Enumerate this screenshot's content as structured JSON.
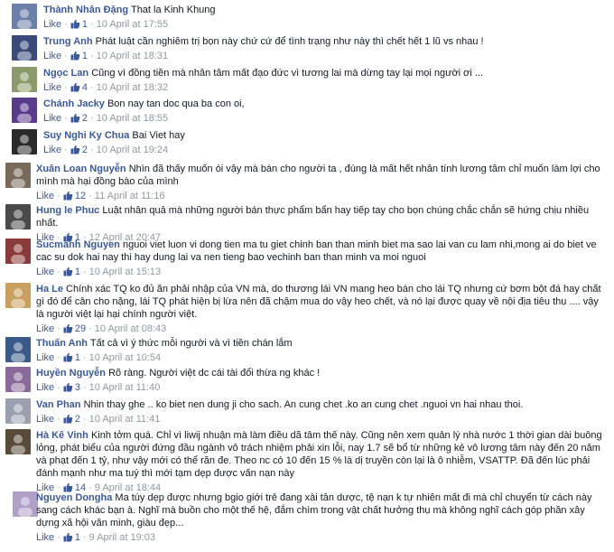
{
  "like_label": "Like",
  "separator": "·",
  "thumb_icon": "thumbs-up-icon",
  "link_color": "#3b5998",
  "comments": [
    {
      "author": "Thành Nhân Đặng",
      "text": "That la Kinh Khung",
      "likes": "1",
      "time": "10 April at 17:55",
      "avatar_color": "#6b7fa8"
    },
    {
      "author": "Trung Anh",
      "text": "Phát luật cần nghiêm trị bọn này chứ cứ để tình trạng như này thì chết hết 1 lũ vs nhau !",
      "likes": "1",
      "time": "10 April at 18:31",
      "avatar_color": "#3a4a7a"
    },
    {
      "author": "Ngọc Lan",
      "text": "Cũng vì đồng tiền mà nhân tâm mất đạo đức vì tương lai mà dừng tay lại mọi người ơi ...",
      "likes": "4",
      "time": "10 April at 18:32",
      "avatar_color": "#8a9a6a"
    },
    {
      "author": "Chánh Jacky",
      "text": "Bon nay tan doc qua ba con oi,",
      "likes": "2",
      "time": "10 April at 18:55",
      "avatar_color": "#5a3a8a"
    },
    {
      "author": "Suy Nghi Ky Chua",
      "text": "Bai Viet hay",
      "likes": "2",
      "time": "10 April at 19:24",
      "avatar_color": "#2a2a2a"
    },
    {
      "author": "Xuân Loan Nguyễn",
      "text": "Nhìn đã thấy muốn ói vậy mà bán cho người ta , đúng là mất hết nhân tính lương tâm chỉ muốn làm lợi cho mình mà hại đồng bào của mình",
      "likes": "12",
      "time": "11 April at 11:16",
      "avatar_color": "#7a6a5a"
    },
    {
      "author": "Hung le Phuc",
      "text": "Luật nhân quả mà những người bán thực phẩm bẩn hay tiếp tay cho bọn chúng chắc chắn sẽ hứng chịu nhiều nhất.",
      "likes": "1",
      "time": "12 April at 20:47",
      "avatar_color": "#4a4a4a"
    },
    {
      "author": "Sucmanh Nguyen",
      "text": "nguoi viet luon vi dong tien ma tu giet chinh ban than minh biet ma sao lai van cu lam nhi,mong ai do biet ve cac su dok hai nay thi hay dung lai va nen tieng bao vechinh ban than minh va moi nguoi",
      "likes": "1",
      "time": "10 April at 15:13",
      "avatar_color": "#8a3a3a"
    },
    {
      "author": "Ha Le",
      "text": "Chính xác TQ ko đủ ăn phải nhập của VN mà, do thương lái VN mang heo bán cho lái TQ nhưng cứ bơm bột đá hay chất gì đó để cân cho nặng, lái TQ phát hiện bị lừa nên đã chậm mua do vậy heo chết, và nó lại được quay về nội địa tiêu thụ .... vậy là người việt lại hại chính người việt.",
      "likes": "29",
      "time": "10 April at 08:43",
      "avatar_color": "#c8a060"
    },
    {
      "author": "Thuấn Anh",
      "text": "Tất cả vì ý thức mỗi người và vì tiền chán lắm",
      "likes": "1",
      "time": "10 April at 10:54",
      "avatar_color": "#3a5a8a"
    },
    {
      "author": "Huyền Nguyễn",
      "text": "Rõ ràng. Người việt dc cái tài đổi thừa ng khác !",
      "likes": "3",
      "time": "10 April at 11:40",
      "avatar_color": "#8a6a9a"
    },
    {
      "author": "Van Phan",
      "text": "Nhin thay ghe .. ko biet nen dung ji cho sach. An cung chet .ko an cung chet .nguoi vn hai nhau thoi.",
      "likes": "2",
      "time": "10 April at 11:41",
      "avatar_color": "#9aa0b0"
    },
    {
      "author": "Hà Kế Vinh",
      "text": "Kinh tởm quá. Chỉ vì liwij nhuận mà làm điều dã tâm thế này. Cũng nên xem quản lý nhà nước 1 thời gian dài buông lỏng, phát biểu của người đứng đầu ngành vô trách nhiệm phải xin lỗi, nay 1.7 sẽ bổ từ những kẻ vô lương tâm này đến 20 năm và phạt đến 1 tỷ, như vậy mới có thể răn đe. Theo nc có 10 đến 15 % là dị truyền còn lại là ô nhiễm, VSATTP. Đã đến lúc phải đánh mạnh như ma tuý thì mới tạm dẹp được vấn nạn này",
      "likes": "14",
      "time": "9 April at 18:44",
      "avatar_color": "#5a4a3a"
    },
    {
      "author": "Nguyen Dongha",
      "text": "Ma túy dẹp được nhưng bgio giới trẻ đang xài tân dược, tệ nạn k tự nhiên mất đi mà chỉ chuyển từ cách này sang cách khác bạn à. Nghĩ mà buồn cho một thế hệ, đắm chìm trong vật chất hưởng thụ mà không nghĩ cách góp phần xây dựng xã hội văn minh, giàu đẹp...",
      "likes": "1",
      "time": "9 April at 19:03",
      "avatar_color": "#b0a0c8"
    }
  ]
}
